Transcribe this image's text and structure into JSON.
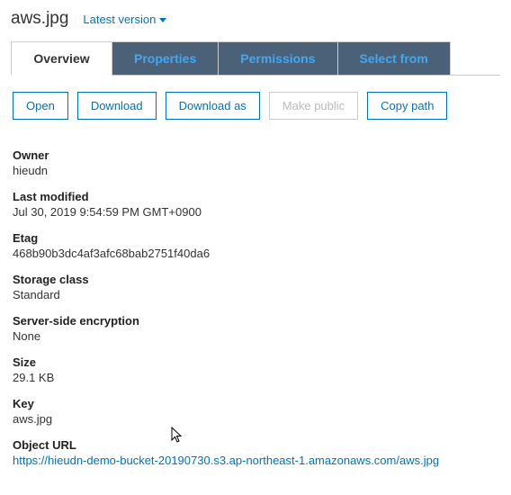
{
  "header": {
    "filename": "aws.jpg",
    "version_label": "Latest version"
  },
  "tabs": {
    "overview": "Overview",
    "properties": "Properties",
    "permissions": "Permissions",
    "select_from": "Select from"
  },
  "actions": {
    "open": "Open",
    "download": "Download",
    "download_as": "Download as",
    "make_public": "Make public",
    "copy_path": "Copy path"
  },
  "fields": {
    "owner": {
      "label": "Owner",
      "value": "hieudn"
    },
    "last_modified": {
      "label": "Last modified",
      "value": "Jul 30, 2019 9:54:59 PM GMT+0900"
    },
    "etag": {
      "label": "Etag",
      "value": "468b90b3dc4af3afc68bab2751f40da6"
    },
    "storage_class": {
      "label": "Storage class",
      "value": "Standard"
    },
    "sse": {
      "label": "Server-side encryption",
      "value": "None"
    },
    "size": {
      "label": "Size",
      "value": "29.1 KB"
    },
    "key": {
      "label": "Key",
      "value": "aws.jpg"
    },
    "object_url": {
      "label": "Object URL",
      "value": "https://hieudn-demo-bucket-20190730.s3.ap-northeast-1.amazonaws.com/aws.jpg"
    }
  }
}
